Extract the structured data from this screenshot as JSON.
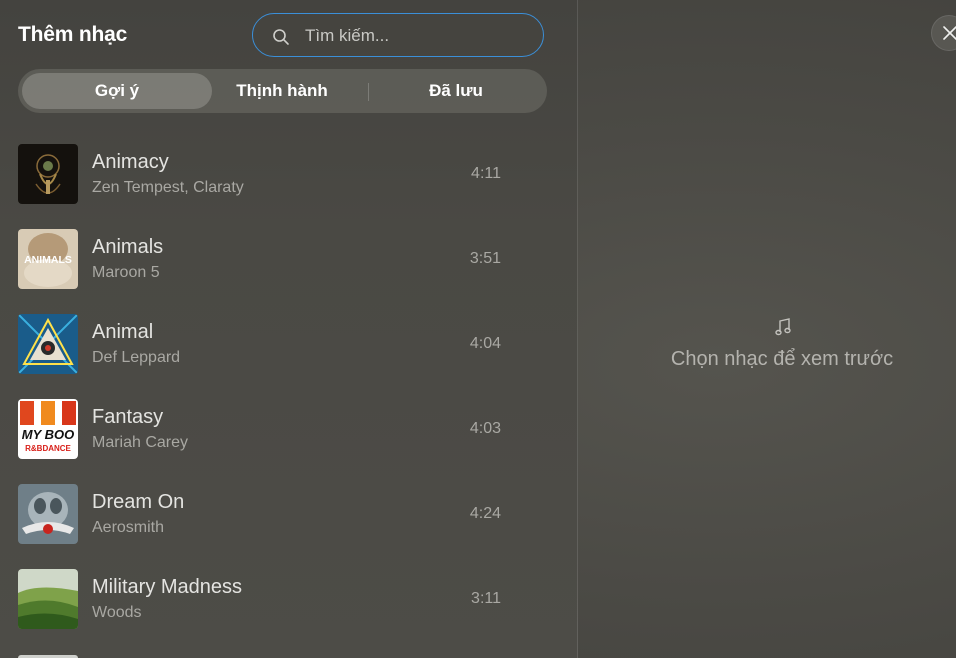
{
  "header": {
    "title": "Thêm nhạc"
  },
  "search": {
    "placeholder": "Tìm kiếm...",
    "icon": "search-icon"
  },
  "tabs": [
    {
      "label": "Gợi ý",
      "active": true
    },
    {
      "label": "Thịnh hành",
      "active": false
    },
    {
      "label": "Đã lưu",
      "active": false
    }
  ],
  "songs": [
    {
      "title": "Animacy",
      "artist": "Zen Tempest, Claraty",
      "duration": "4:11"
    },
    {
      "title": "Animals",
      "artist": "Maroon 5",
      "duration": "3:51",
      "cover_text": "ANIMALS"
    },
    {
      "title": "Animal",
      "artist": "Def Leppard",
      "duration": "4:04"
    },
    {
      "title": "Fantasy",
      "artist": "Mariah Carey",
      "duration": "4:03",
      "cover_text": "MY BOO",
      "cover_subtext": "R&BDANCE"
    },
    {
      "title": "Dream On",
      "artist": "Aerosmith",
      "duration": "4:24"
    },
    {
      "title": "Military Madness",
      "artist": "Woods",
      "duration": "3:11"
    }
  ],
  "preview": {
    "icon": "music-note-icon",
    "empty_text": "Chọn nhạc để xem trước"
  },
  "close_icon": "close-icon",
  "colors": {
    "accent": "#3b8fd8",
    "background": "#4a4944"
  }
}
